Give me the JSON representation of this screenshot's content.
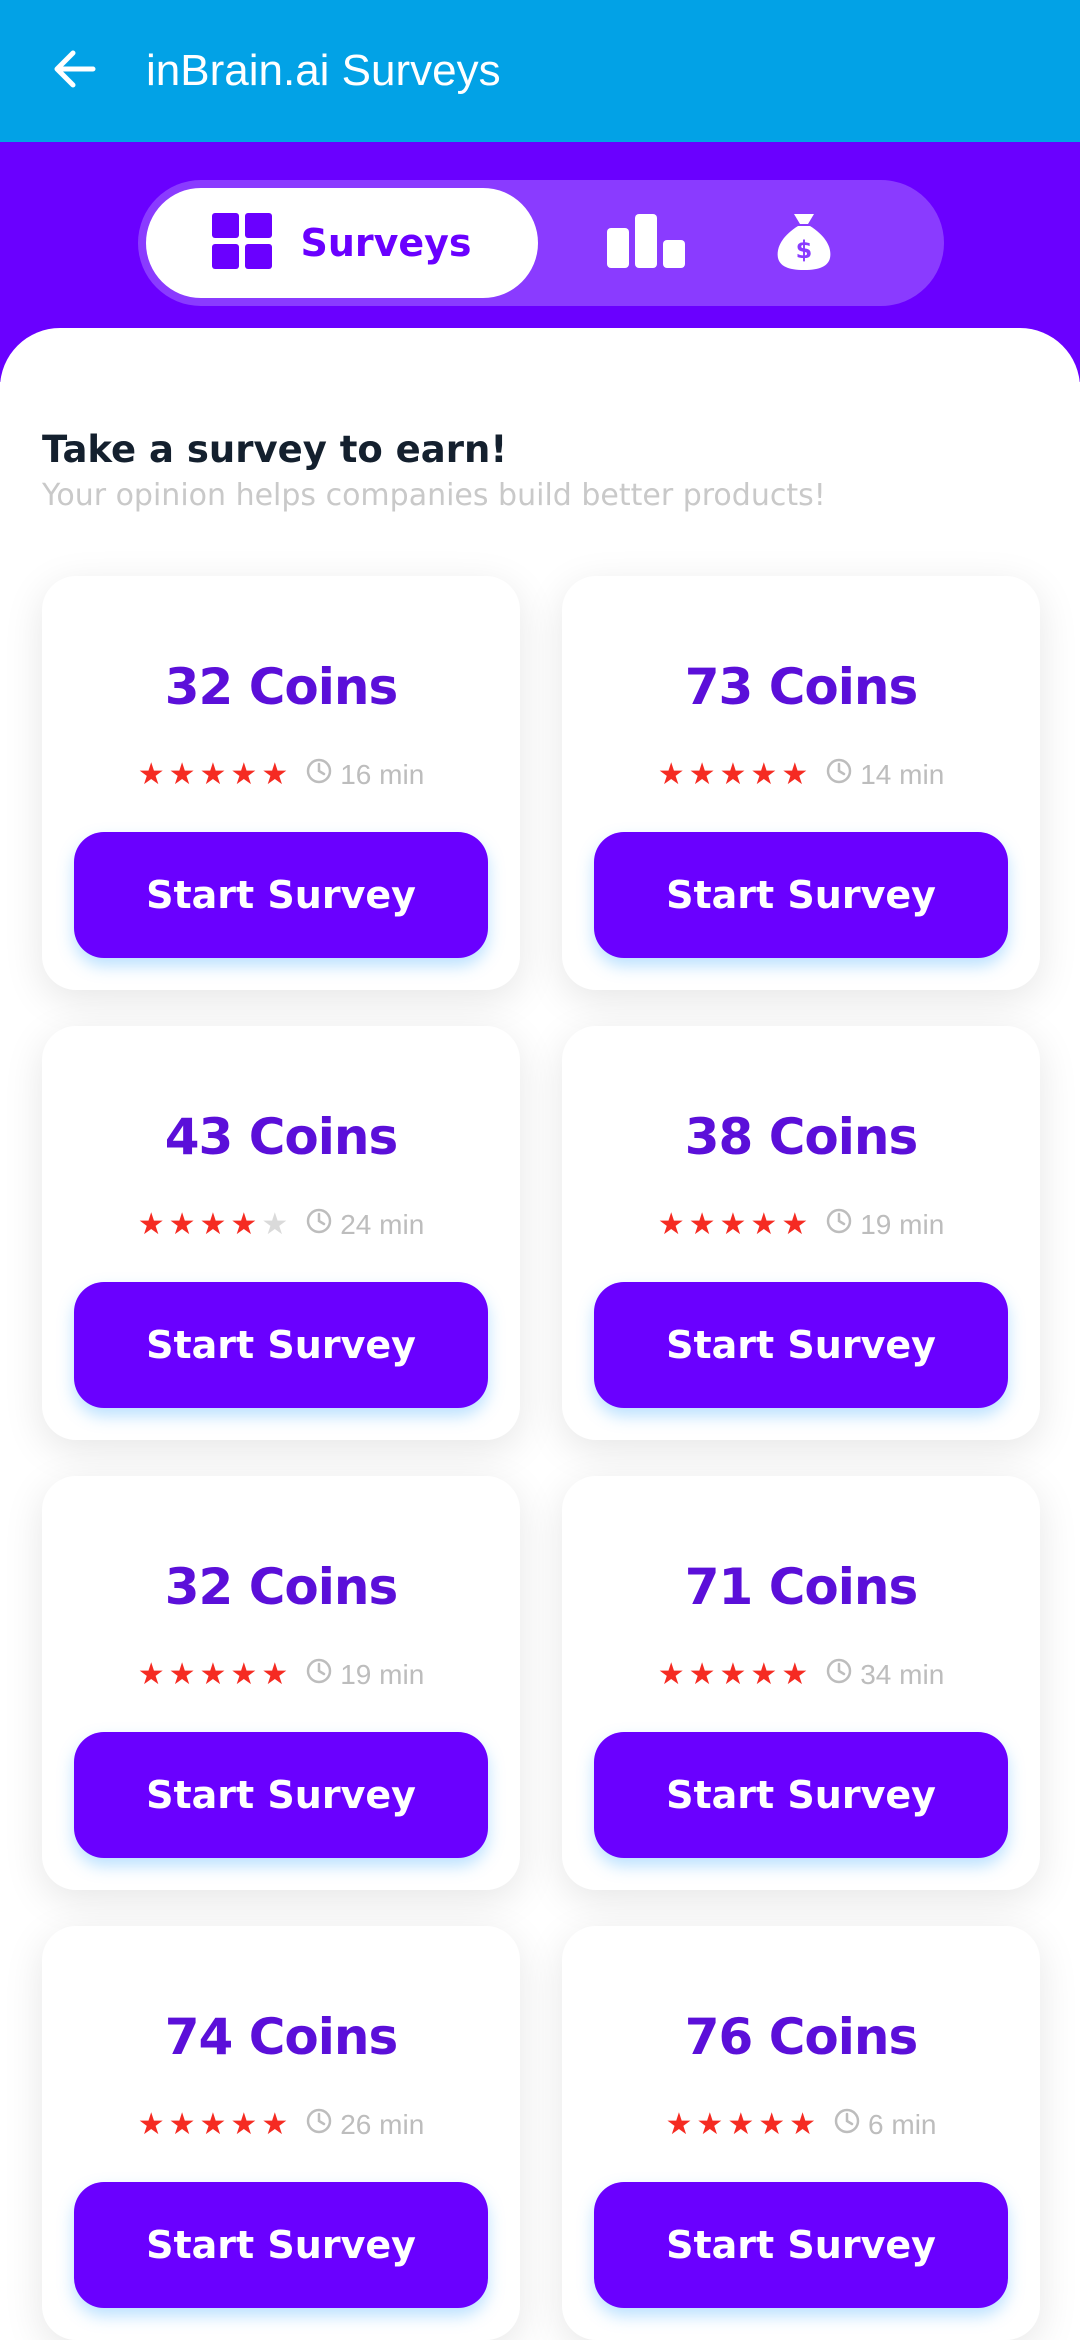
{
  "app_bar": {
    "title": "inBrain.ai Surveys",
    "back_icon": "arrow-left-icon",
    "background": "#02A2E6"
  },
  "tabs": {
    "active_label": "Surveys",
    "active_icon": "grid-icon",
    "items": [
      {
        "icon": "bar-chart-icon"
      },
      {
        "icon": "money-bag-icon"
      }
    ],
    "band_color": "#6A00FF"
  },
  "intro": {
    "title": "Take a survey to earn!",
    "subtitle": "Your opinion helps companies build better products!"
  },
  "surveys": [
    {
      "coins": "32 Coins",
      "rating": 5,
      "duration": "16 min",
      "button": "Start Survey"
    },
    {
      "coins": "73 Coins",
      "rating": 5,
      "duration": "14 min",
      "button": "Start Survey"
    },
    {
      "coins": "43 Coins",
      "rating": 4,
      "duration": "24 min",
      "button": "Start Survey"
    },
    {
      "coins": "38 Coins",
      "rating": 5,
      "duration": "19 min",
      "button": "Start Survey"
    },
    {
      "coins": "32 Coins",
      "rating": 5,
      "duration": "19 min",
      "button": "Start Survey"
    },
    {
      "coins": "71 Coins",
      "rating": 5,
      "duration": "34 min",
      "button": "Start Survey"
    },
    {
      "coins": "74 Coins",
      "rating": 5,
      "duration": "26 min",
      "button": "Start Survey"
    },
    {
      "coins": "76 Coins",
      "rating": 5,
      "duration": "6 min",
      "button": "Start Survey"
    }
  ],
  "colors": {
    "accent": "#6A00FF",
    "coins_text": "#5B0FD9",
    "star": "#F52B22",
    "star_empty": "#DADADA"
  }
}
